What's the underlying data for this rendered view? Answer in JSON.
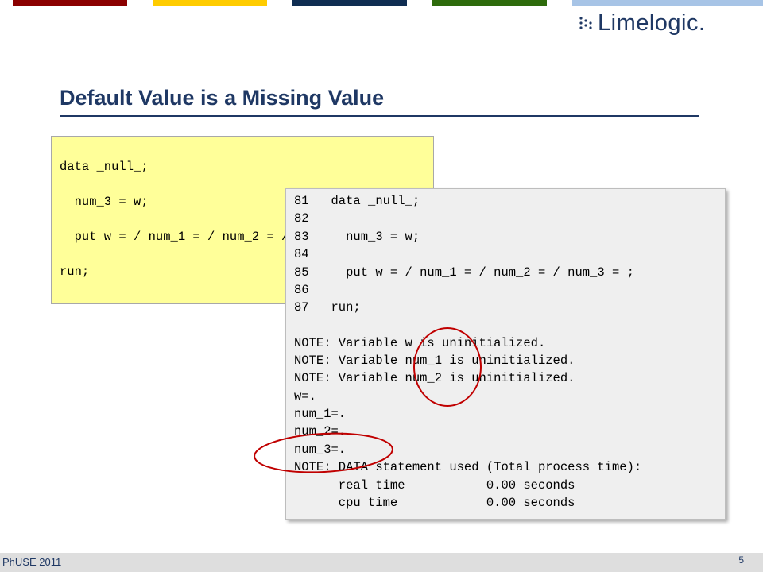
{
  "colors": {
    "bar_1": "#8b0000",
    "bar_2": "#ffcc00",
    "bar_3": "#0f2d52",
    "bar_4": "#2e6b0c",
    "bar_5": "#a7c4e6",
    "title": "#1f3864",
    "rule": "#1f3864",
    "logo_text": "#1f3864",
    "annotation": "#c00000"
  },
  "header": {
    "logo_text": "Limelogic.",
    "logo_icon": "grid-dots-icon"
  },
  "slide": {
    "title": "Default Value is a Missing Value"
  },
  "code_box": {
    "lines": [
      "data _null_;",
      "  num_3 = w;",
      "  put w = / num_1 = / num_2 = / num_3 = ;",
      "run;"
    ]
  },
  "log_box": {
    "lines": [
      "81   data _null_;",
      "82",
      "83     num_3 = w;",
      "84",
      "85     put w = / num_1 = / num_2 = / num_3 = ;",
      "86",
      "87   run;",
      "",
      "NOTE: Variable w is uninitialized.",
      "NOTE: Variable num_1 is uninitialized.",
      "NOTE: Variable num_2 is uninitialized.",
      "w=.",
      "num_1=.",
      "num_2=.",
      "num_3=.",
      "NOTE: DATA statement used (Total process time):",
      "      real time           0.00 seconds",
      "      cpu time            0.00 seconds"
    ]
  },
  "footer": {
    "left": "PhUSE 2011",
    "page_number": "5"
  }
}
